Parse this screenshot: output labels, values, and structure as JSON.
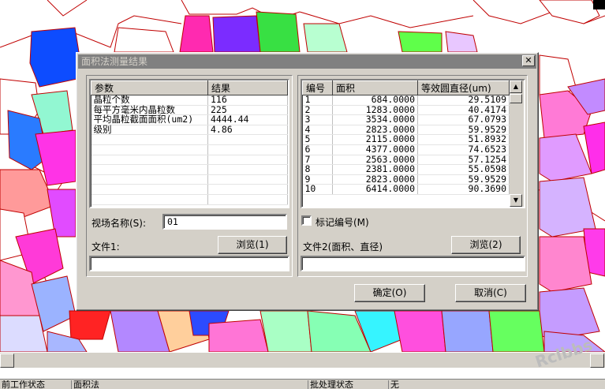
{
  "dialog": {
    "title": "面积法测量结果",
    "close_glyph": "✕",
    "left_table": {
      "headers": [
        "参数",
        "结果"
      ],
      "rows": [
        [
          "晶粒个数",
          "116"
        ],
        [
          "每平方毫米内晶粒数",
          "225"
        ],
        [
          "平均晶粒截面面积(um2)",
          "4444.44"
        ],
        [
          "级别",
          "4.86"
        ]
      ]
    },
    "view_name_label": "视场名称(S):",
    "view_name_value": "01",
    "file1_label": "文件1:",
    "browse1_label": "浏览(1)",
    "file1_value": "",
    "right_table": {
      "headers": [
        "编号",
        "面积",
        "等效圆直径(um)"
      ],
      "rows": [
        [
          "1",
          "684.0000",
          "29.5109"
        ],
        [
          "2",
          "1283.0000",
          "40.4174"
        ],
        [
          "3",
          "3534.0000",
          "67.0793"
        ],
        [
          "4",
          "2823.0000",
          "59.9529"
        ],
        [
          "5",
          "2115.0000",
          "51.8932"
        ],
        [
          "6",
          "4377.0000",
          "74.6523"
        ],
        [
          "7",
          "2563.0000",
          "57.1254"
        ],
        [
          "8",
          "2381.0000",
          "55.0598"
        ],
        [
          "9",
          "2823.0000",
          "59.9529"
        ],
        [
          "10",
          "6414.0000",
          "90.3690"
        ]
      ]
    },
    "mark_label": "标记编号(M)",
    "mark_checked": false,
    "file2_label": "文件2(面积、直径)",
    "browse2_label": "浏览(2)",
    "file2_value": "",
    "ok_label": "确定(O)",
    "cancel_label": "取消(C)"
  },
  "statusbar": {
    "cells": [
      "前工作状态",
      "面积法",
      "批处理状态",
      "无"
    ]
  },
  "watermark": "Rclbbs",
  "colors": {
    "dialog_face": "#d4d0c8",
    "titlebar_inactive": "#808080",
    "grain_boundary": "#c00000"
  }
}
